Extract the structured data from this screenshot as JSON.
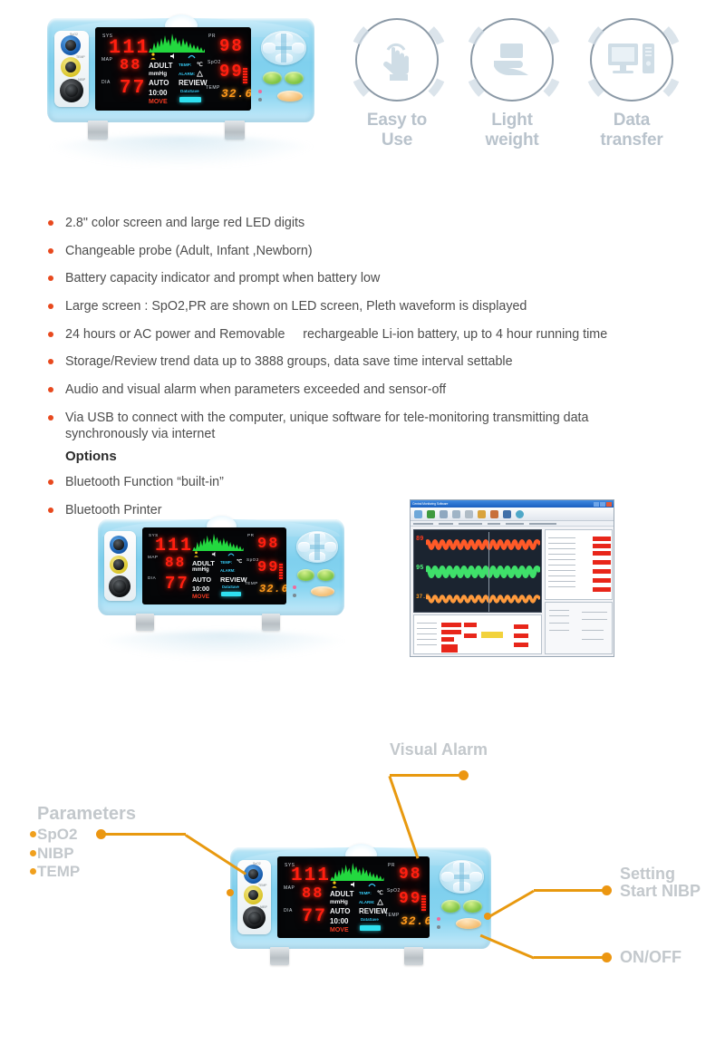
{
  "device": {
    "screen": {
      "sys_label": "SYS",
      "sys_value": "111",
      "map_label": "MAP",
      "map_value": "88",
      "dia_label": "DIA",
      "dia_value": "77",
      "pr_label": "PR",
      "pr_value": "98",
      "spo2_label": "SpO2",
      "spo2_value": "99",
      "temp_label": "TEMP",
      "temp_value": "32.6",
      "mode_patient": "ADULT",
      "unit": "mmHg",
      "mode_auto": "AUTO",
      "countdown": "10:00",
      "move_status": "MOVE",
      "temp_unit_label": "TEMP:",
      "temp_unit": "℃",
      "alarm_setup_label": "ALARM:",
      "review_label": "REVIEW",
      "data_save_label": "DataSave",
      "accent_red": "#ff1f10",
      "accent_orange": "#ff9a1c",
      "accent_green": "#23d83f",
      "accent_cyan": "#35c8f2"
    },
    "connectors": [
      {
        "name": "SpO2",
        "color": "#1256a8"
      },
      {
        "name": "TEMP",
        "color": "#d9c428"
      },
      {
        "name": "NIBP",
        "color": "#0c0e10"
      }
    ],
    "body_color": "#7fd0ee"
  },
  "features": [
    {
      "label": "Easy to Use",
      "icon": "hand-tap-icon"
    },
    {
      "label": "Light weight",
      "icon": "hand-holding-box-icon"
    },
    {
      "label": "Data transfer",
      "icon": "monitor-tower-icon"
    }
  ],
  "bullets": [
    "2.8\" color screen and large red LED digits",
    "Changeable probe (Adult, Infant ,Newborn)",
    "Battery capacity indicator and prompt when battery low",
    "Large screen : SpO2,PR are shown on LED screen, Pleth waveform is displayed",
    "24 hours or AC power and Removable     rechargeable Li-ion battery, up to 4 hour running time",
    "Storage/Review trend data up to 3888 groups, data save time interval settable",
    "Audio and visual alarm when parameters exceeded and sensor-off",
    "Via USB to connect with the computer, unique software for tele-monitoring  transmitting data\n synchronously via internet"
  ],
  "options_heading": "Options",
  "option_bullets": [
    "Bluetooth Function “built-in”",
    "Bluetooth Printer"
  ],
  "software": {
    "title": "Central Monitoring Software",
    "values": [
      "89",
      "95",
      "37.5"
    ],
    "value_colors": [
      "#ff3b1e",
      "#4ef07a",
      "#ff9a1c"
    ]
  },
  "callouts": {
    "visual_alarm": "Visual Alarm",
    "parameters_title": "Parameters",
    "parameters_items": [
      "SpO2",
      "NIBP",
      "TEMP"
    ],
    "setting_nibp": "Setting\nStart NIBP",
    "on_off": "ON/OFF",
    "line_color": "#e8990f"
  }
}
